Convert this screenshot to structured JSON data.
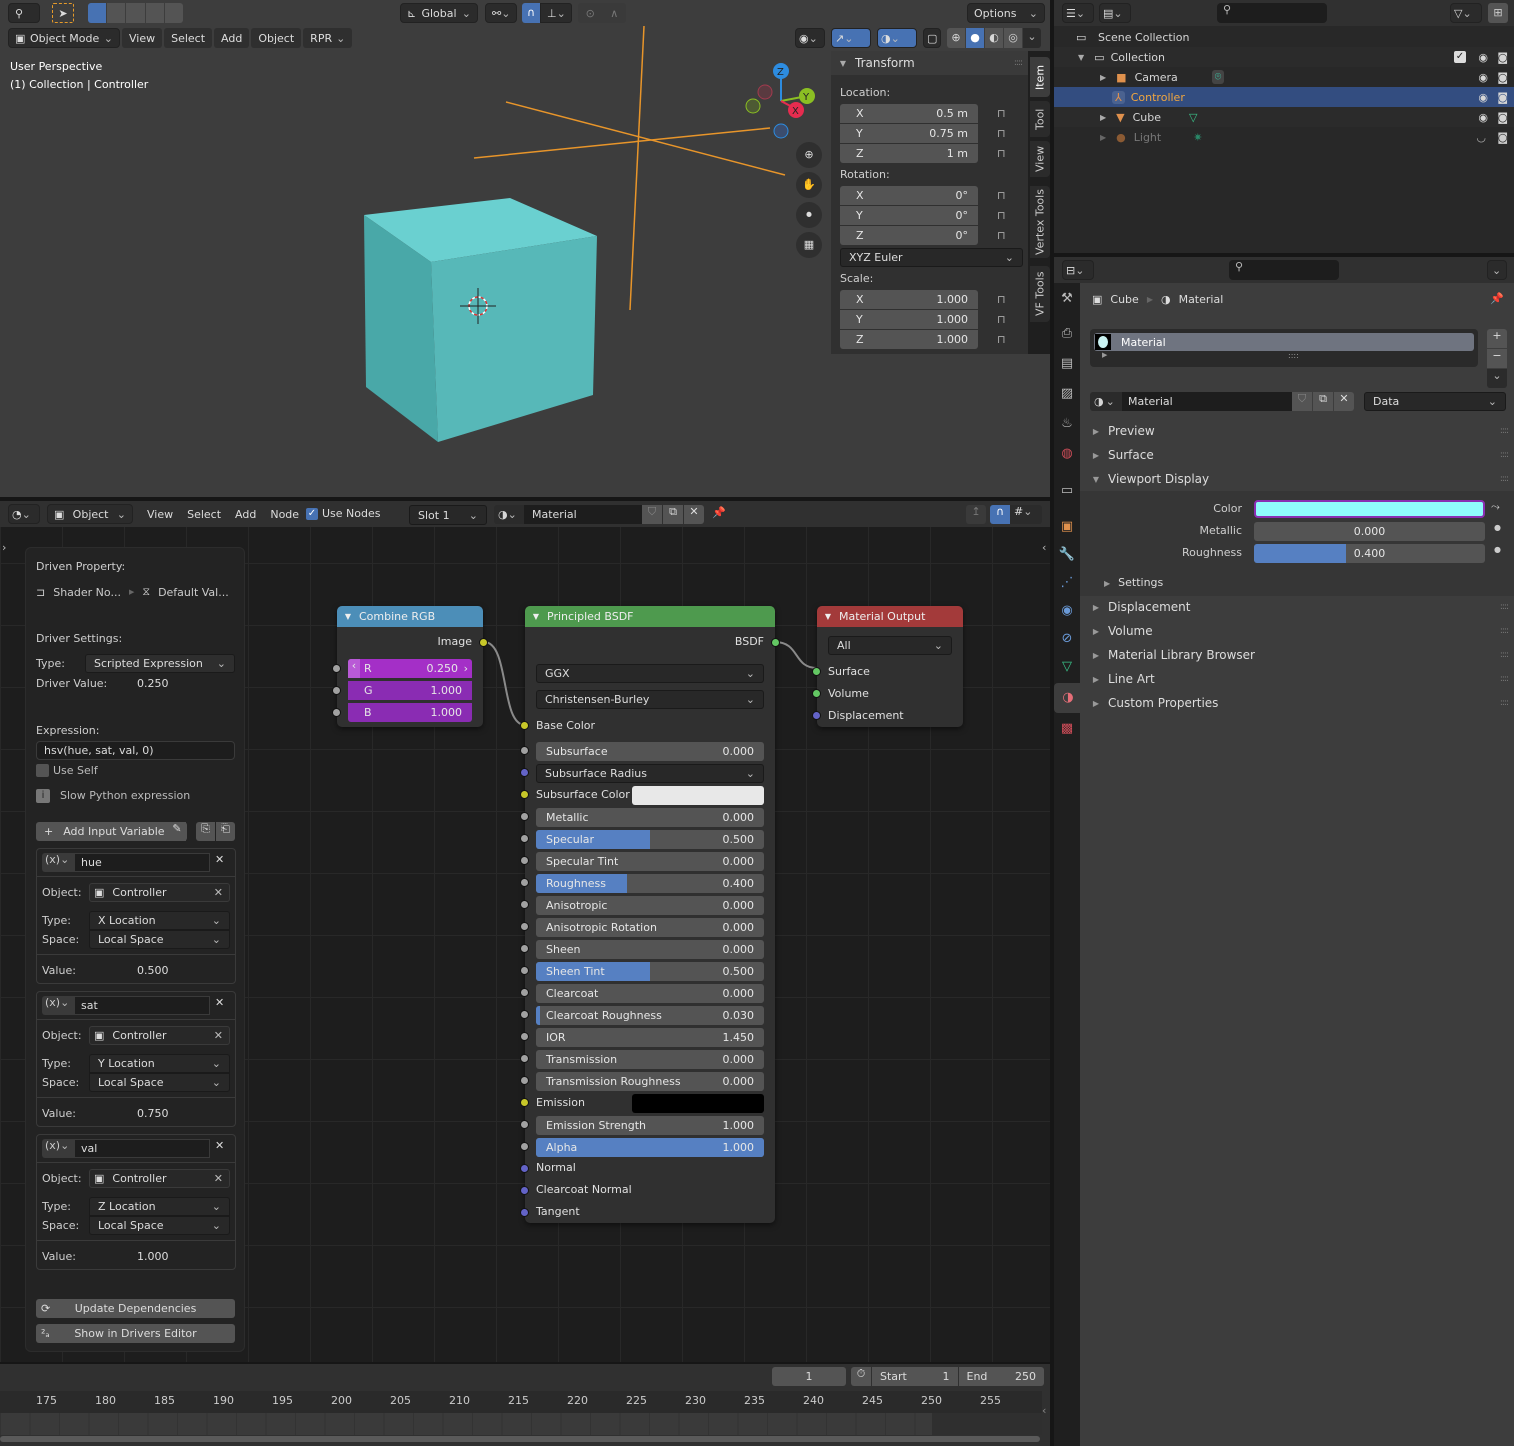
{
  "viewport": {
    "header": {
      "orientation": "Global",
      "options": "Options"
    },
    "menu": {
      "mode": "Object Mode",
      "items": [
        "View",
        "Select",
        "Add",
        "Object",
        "RPR"
      ]
    },
    "overlay_text": {
      "line1": "User Perspective",
      "line2": "(1) Collection | Controller"
    },
    "gizmo": {
      "z": "Z",
      "y": "Y",
      "x": "X"
    },
    "object_color": "#57b3b3",
    "sidebar": {
      "tabs": [
        "Item",
        "Tool",
        "View",
        "Vertex Tools",
        "VF Tools"
      ],
      "panel_title": "Transform",
      "location_label": "Location:",
      "location": [
        {
          "axis": "X",
          "value": "0.5 m"
        },
        {
          "axis": "Y",
          "value": "0.75 m"
        },
        {
          "axis": "Z",
          "value": "1 m"
        }
      ],
      "rotation_label": "Rotation:",
      "rotation": [
        {
          "axis": "X",
          "value": "0°"
        },
        {
          "axis": "Y",
          "value": "0°"
        },
        {
          "axis": "Z",
          "value": "0°"
        }
      ],
      "rotation_mode": "XYZ Euler",
      "scale_label": "Scale:",
      "scale": [
        {
          "axis": "X",
          "value": "1.000"
        },
        {
          "axis": "Y",
          "value": "1.000"
        },
        {
          "axis": "Z",
          "value": "1.000"
        }
      ]
    }
  },
  "outliner": {
    "scene_collection": "Scene Collection",
    "items": [
      {
        "name": "Collection",
        "type": "collection"
      },
      {
        "name": "Camera",
        "type": "camera"
      },
      {
        "name": "Controller",
        "type": "empty",
        "selected": true
      },
      {
        "name": "Cube",
        "type": "mesh"
      },
      {
        "name": "Light",
        "type": "light",
        "hidden": true
      }
    ]
  },
  "properties": {
    "breadcrumb": {
      "object": "Cube",
      "material": "Material"
    },
    "slot": "Material",
    "material_name": "Material",
    "link": "Data",
    "panels": [
      "Preview",
      "Surface",
      "Viewport Display",
      "Displacement",
      "Volume",
      "Material Library Browser",
      "Line Art",
      "Custom Properties"
    ],
    "viewport_display": {
      "color_label": "Color",
      "color": "#8ffcfc",
      "metallic_label": "Metallic",
      "metallic": "0.000",
      "roughness_label": "Roughness",
      "roughness": "0.400",
      "roughness_fraction": 0.4,
      "settings": "Settings"
    }
  },
  "node_editor": {
    "header": {
      "editor": "Object",
      "menus": [
        "View",
        "Select",
        "Add",
        "Node"
      ],
      "use_nodes": "Use Nodes",
      "slot": "Slot 1",
      "material": "Material"
    },
    "driver": {
      "driven_property_label": "Driven Property:",
      "path1": "Shader No...",
      "path2": "Default Val...",
      "settings_label": "Driver Settings:",
      "type_label": "Type:",
      "type": "Scripted Expression",
      "value_label": "Driver Value:",
      "value": "0.250",
      "expression_label": "Expression:",
      "expression": "hsv(hue, sat, val, 0)",
      "use_self": "Use Self",
      "warning": "Slow Python expression",
      "add_var": "Add Input Variable",
      "variables": [
        {
          "name": "hue",
          "object": "Controller",
          "type": "X Location",
          "space": "Local Space",
          "value": "0.500"
        },
        {
          "name": "sat",
          "object": "Controller",
          "type": "Y Location",
          "space": "Local Space",
          "value": "0.750"
        },
        {
          "name": "val",
          "object": "Controller",
          "type": "Z Location",
          "space": "Local Space",
          "value": "1.000"
        }
      ],
      "labels": {
        "object": "Object:",
        "type": "Type:",
        "space": "Space:",
        "value": "Value:"
      },
      "update": "Update Dependencies",
      "show_in_editor": "Show in Drivers Editor"
    },
    "combine_rgb": {
      "title": "Combine RGB",
      "output": "Image",
      "inputs": [
        {
          "name": "R",
          "value": "0.250"
        },
        {
          "name": "G",
          "value": "1.000"
        },
        {
          "name": "B",
          "value": "1.000"
        }
      ]
    },
    "bsdf": {
      "title": "Principled BSDF",
      "output": "BSDF",
      "distribution": "GGX",
      "subsurface_method": "Christensen-Burley",
      "base_color": "Base Color",
      "rows": [
        {
          "name": "Subsurface",
          "value": "0.000",
          "fill": 0
        },
        {
          "name": "Subsurface Radius",
          "dropdown": true
        },
        {
          "name": "Subsurface Color",
          "color": "#e8e8e8"
        },
        {
          "name": "Metallic",
          "value": "0.000",
          "fill": 0
        },
        {
          "name": "Specular",
          "value": "0.500",
          "fill": 0.5
        },
        {
          "name": "Specular Tint",
          "value": "0.000",
          "fill": 0
        },
        {
          "name": "Roughness",
          "value": "0.400",
          "fill": 0.4
        },
        {
          "name": "Anisotropic",
          "value": "0.000",
          "fill": 0
        },
        {
          "name": "Anisotropic Rotation",
          "value": "0.000",
          "fill": 0
        },
        {
          "name": "Sheen",
          "value": "0.000",
          "fill": 0
        },
        {
          "name": "Sheen Tint",
          "value": "0.500",
          "fill": 0.5
        },
        {
          "name": "Clearcoat",
          "value": "0.000",
          "fill": 0
        },
        {
          "name": "Clearcoat Roughness",
          "value": "0.030",
          "fill": 0.03
        },
        {
          "name": "IOR",
          "value": "1.450",
          "fill": 0
        },
        {
          "name": "Transmission",
          "value": "0.000",
          "fill": 0
        },
        {
          "name": "Transmission Roughness",
          "value": "0.000",
          "fill": 0
        },
        {
          "name": "Emission",
          "color": "#000000"
        },
        {
          "name": "Emission Strength",
          "value": "1.000",
          "fill": 0
        },
        {
          "name": "Alpha",
          "value": "1.000",
          "fill": 1
        }
      ],
      "vectors": [
        "Normal",
        "Clearcoat Normal",
        "Tangent"
      ]
    },
    "output": {
      "title": "Material Output",
      "target": "All",
      "inputs": [
        "Surface",
        "Volume",
        "Displacement"
      ]
    }
  },
  "timeline": {
    "current": "1",
    "start_label": "Start",
    "start": "1",
    "end_label": "End",
    "end": "250",
    "ticks": [
      "175",
      "180",
      "185",
      "190",
      "195",
      "200",
      "205",
      "210",
      "215",
      "220",
      "225",
      "230",
      "235",
      "240",
      "245",
      "250",
      "255"
    ]
  }
}
